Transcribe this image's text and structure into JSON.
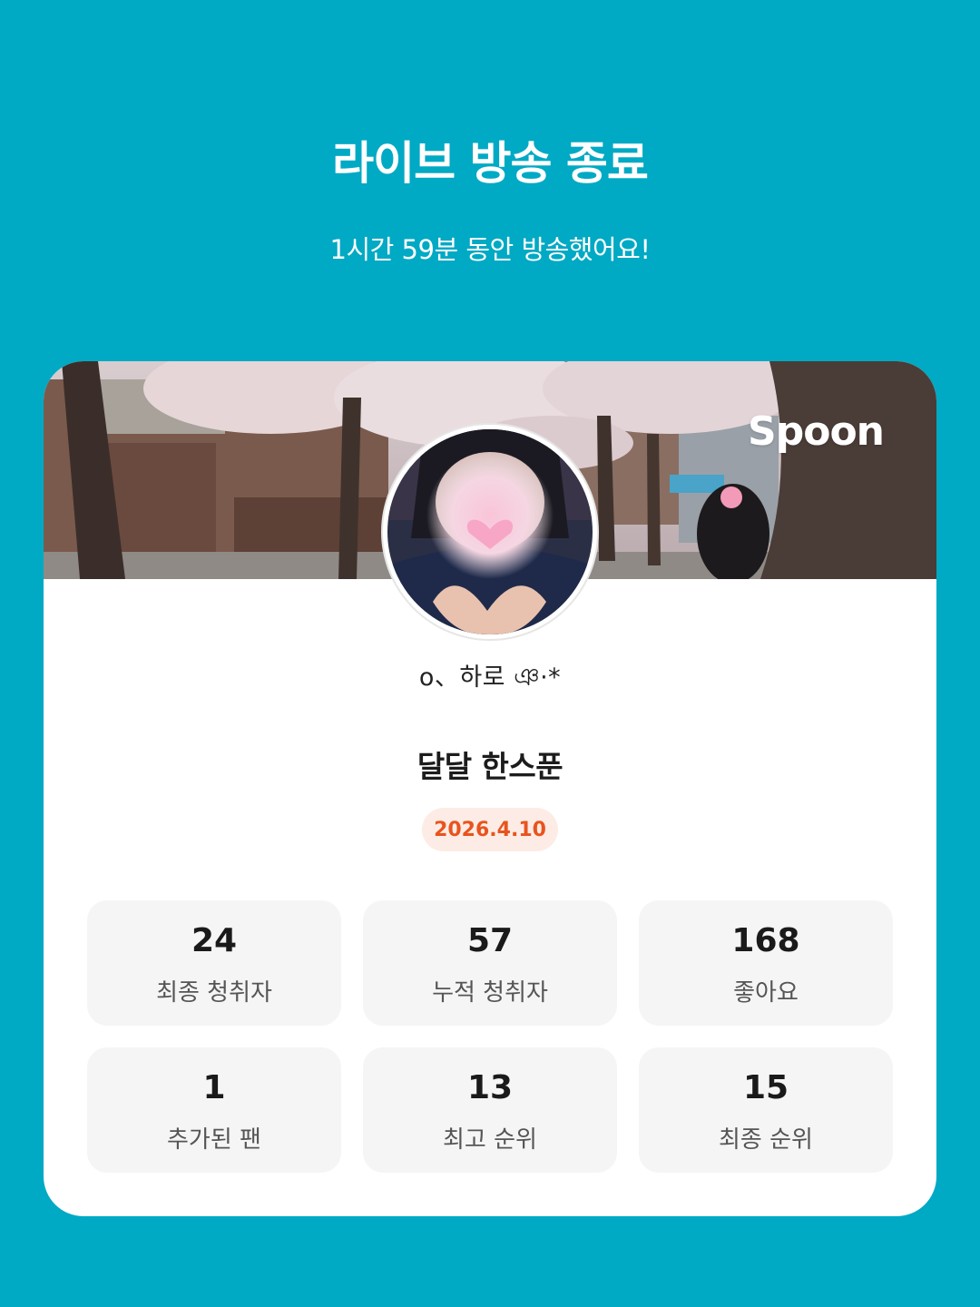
{
  "header": {
    "title": "라이브 방송 종료",
    "subtitle": "1시간 59분 동안 방송했어요!"
  },
  "card": {
    "logo_text": "Spoon",
    "nickname": "ο、하로    ঞ·*",
    "broadcast_title": "달달 한스푼",
    "date": "2026.4.10",
    "stats": [
      {
        "value": "24",
        "label": "최종 청취자"
      },
      {
        "value": "57",
        "label": "누적 청취자"
      },
      {
        "value": "168",
        "label": "좋아요"
      },
      {
        "value": "1",
        "label": "추가된 팬"
      },
      {
        "value": "13",
        "label": "최고 순위"
      },
      {
        "value": "15",
        "label": "최종 순위"
      }
    ]
  },
  "colors": {
    "background": "#00A9C4",
    "badge_bg": "#FDECE5",
    "badge_text": "#E8541E",
    "stat_bg": "#F5F5F5"
  }
}
